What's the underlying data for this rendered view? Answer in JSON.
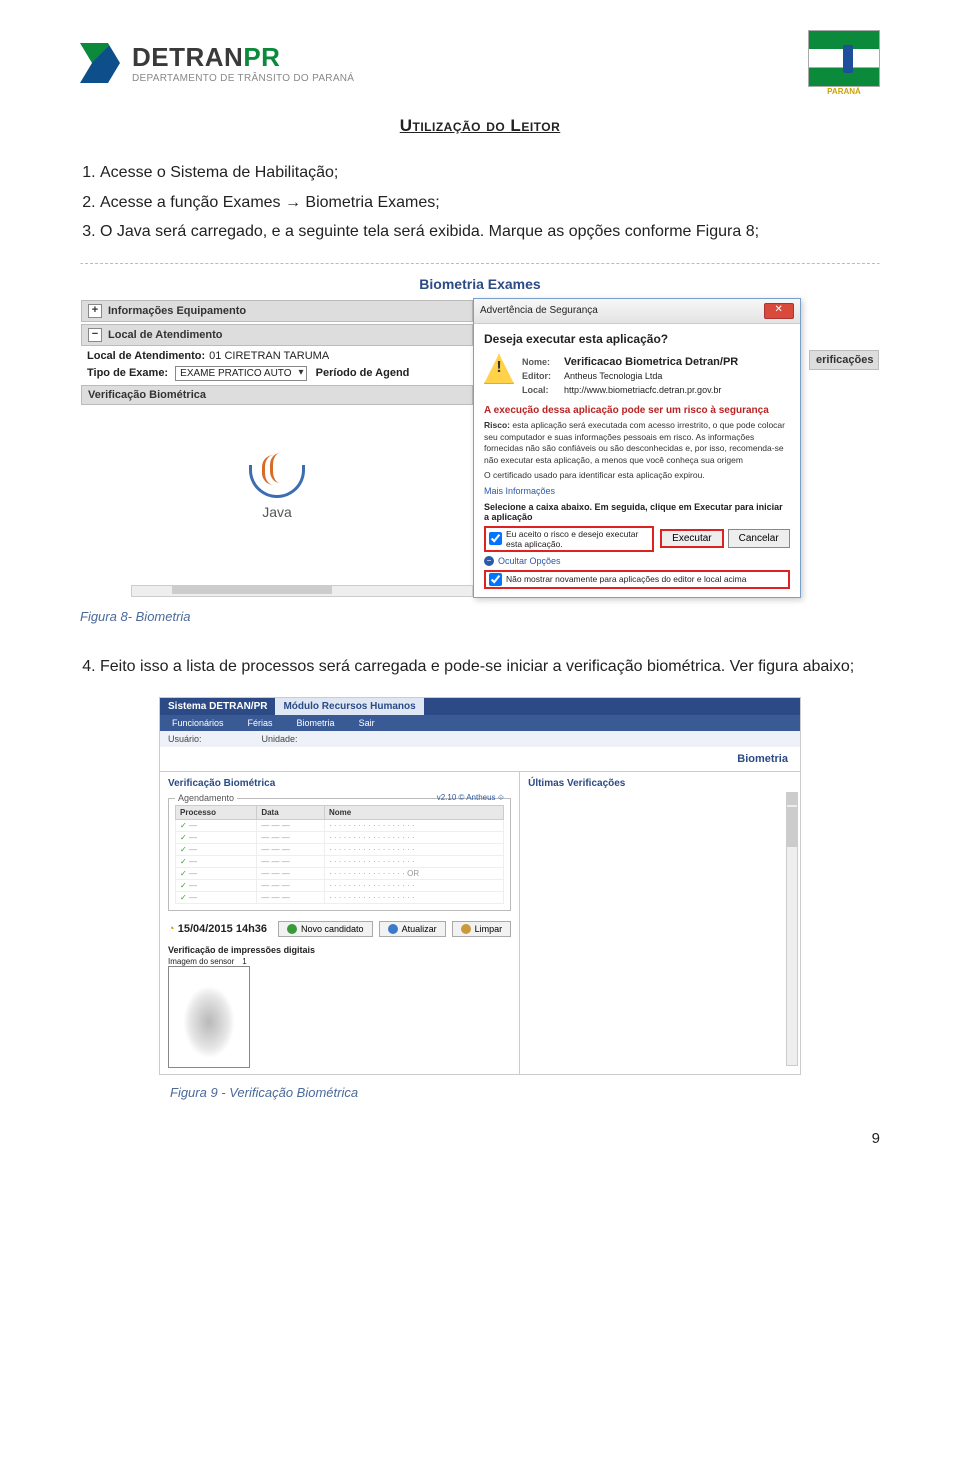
{
  "header": {
    "brand": "DETRAN",
    "brand_accent": "PR",
    "subtitle": "DEPARTAMENTO DE TRÂNSITO DO PARANÁ",
    "right_label": "PARANÁ"
  },
  "doc": {
    "section_title": "Utilização do Leitor",
    "list": [
      "Acesse o Sistema de Habilitação;",
      "Acesse a função Exames → Biometria Exames;",
      "O Java será carregado, e a seguinte tela será exibida. Marque as opções conforme Figura 8;"
    ],
    "caption8": "Figura 8- Biometria",
    "item4": "Feito isso a lista de processos será carregada e pode-se iniciar a verificação biométrica. Ver figura abaixo;",
    "caption9": "Figura 9 - Verificação Biométrica",
    "page_number": "9"
  },
  "fig8": {
    "page_title": "Biometria Exames",
    "bars": {
      "info_equip": "Informações Equipamento",
      "local_atend": "Local de Atendimento",
      "verif_bio": "Verificação Biométrica",
      "verificacoes": "erificações"
    },
    "local_label": "Local de Atendimento:",
    "local_value": "01 CIRETRAN TARUMA",
    "tipo_label": "Tipo de Exame:",
    "tipo_value": "EXAME PRATICO AUTO",
    "periodo_label": "Período de Agend",
    "java_label": "Java",
    "dialog": {
      "title": "Advertência de Segurança",
      "question": "Deseja executar esta aplicação?",
      "name_label": "Nome:",
      "name": "Verificacao Biometrica Detran/PR",
      "editor_label": "Editor:",
      "editor": "Antheus Tecnologia Ltda",
      "local_label": "Local:",
      "local": "http://www.biometriacfc.detran.pr.gov.br",
      "red_warning": "A execução dessa aplicação pode ser um risco à segurança",
      "risk_label": "Risco:",
      "risk_text": "esta aplicação será executada com acesso irrestrito, o que pode colocar seu computador e suas informações pessoais em risco. As informações fornecidas não são confiáveis ou são desconhecidas e, por isso, recomenda-se não executar esta aplicação, a menos que você conheça sua origem",
      "cert_text": "O certificado usado para identificar esta aplicação expirou.",
      "more_info": "Mais Informações",
      "select_line": "Selecione a caixa abaixo. Em seguida, clique em Executar para iniciar a aplicação",
      "chk1": "Eu aceito o risco e desejo executar esta aplicação.",
      "btn_exec": "Executar",
      "btn_cancel": "Cancelar",
      "hide_opts": "Ocultar Opções",
      "chk2": "Não mostrar novamente para aplicações do editor e local acima"
    }
  },
  "fig9": {
    "system": "Sistema DETRAN/PR",
    "module": "Módulo Recursos Humanos",
    "tabs": [
      "Funcionários",
      "Férias",
      "Biometria",
      "Sair"
    ],
    "subrow": {
      "user_label": "Usuário:",
      "unit_label": "Unidade:"
    },
    "page_title": "Biometria",
    "left_header": "Verificação Biométrica",
    "right_header": "Últimas Verificações",
    "fieldset_legend": "Agendamento",
    "version": "v2.10 © Antheus",
    "columns": [
      "Processo",
      "Data",
      "Nome"
    ],
    "rows": [
      {
        "p": "—",
        "d": "— — —",
        "n": "· · · · · · · · · · · · · · · · · ·",
        "st": "ok"
      },
      {
        "p": "—",
        "d": "— — —",
        "n": "· · · · · · · · · · · · · · · · · ·",
        "st": "ok"
      },
      {
        "p": "—",
        "d": "— — —",
        "n": "· · · · · · · · · · · · · · · · · ·",
        "st": "ok"
      },
      {
        "p": "—",
        "d": "— — —",
        "n": "· · · · · · · · · · · · · · · · · ·",
        "st": "ok"
      },
      {
        "p": "—",
        "d": "— — —",
        "n": "· · · · · · · · · · · · · · · · OR",
        "st": "ok"
      },
      {
        "p": "—",
        "d": "— — —",
        "n": "· · · · · · · · · · · · · · · · · ·",
        "st": "ok"
      },
      {
        "p": "—",
        "d": "— — —",
        "n": "· · · · · · · · · · · · · · · · · ·",
        "st": "ok"
      }
    ],
    "now": "15/04/2015 14h36",
    "btn_new": "Novo candidato",
    "btn_refresh": "Atualizar",
    "btn_clear": "Limpar",
    "sec2": "Verificação de impressões digitais",
    "sensor_label": "Imagem do sensor",
    "sensor_num": "1"
  }
}
